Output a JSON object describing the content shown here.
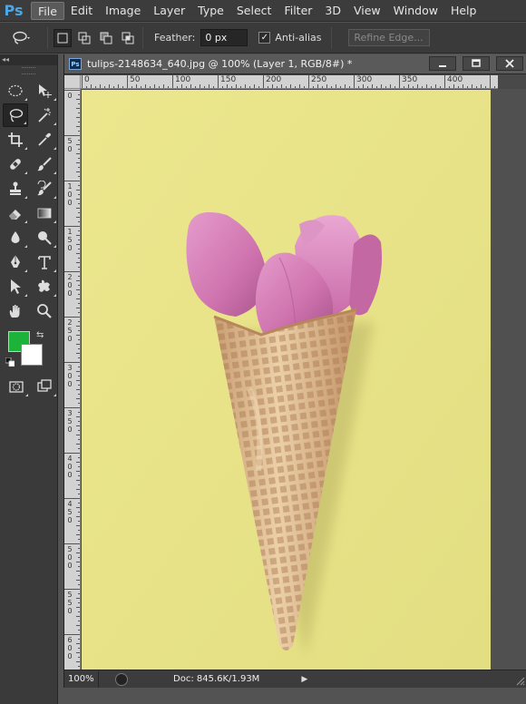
{
  "app": {
    "logo": "Ps"
  },
  "menu": [
    "File",
    "Edit",
    "Image",
    "Layer",
    "Type",
    "Select",
    "Filter",
    "3D",
    "View",
    "Window",
    "Help"
  ],
  "options": {
    "feather_label": "Feather:",
    "feather_value": "0 px",
    "antialias_label": "Anti-alias",
    "antialias_checked": true,
    "refine_edge_label": "Refine Edge..."
  },
  "toolbox": {
    "header": "◂◂",
    "tools": [
      "marquee-icon",
      "move-icon",
      "lasso-icon",
      "magic-wand-icon",
      "crop-icon",
      "eyedropper-icon",
      "healing-brush-icon",
      "brush-icon",
      "clone-stamp-icon",
      "history-brush-icon",
      "eraser-icon",
      "gradient-icon",
      "blur-icon",
      "dodge-icon",
      "pen-icon",
      "type-icon",
      "path-selection-icon",
      "custom-shape-icon",
      "hand-icon",
      "zoom-icon"
    ],
    "foreground_color": "#1db33a",
    "background_color": "#ffffff"
  },
  "document": {
    "title": "tulips-2148634_640.jpg @ 100% (Layer 1, RGB/8#) *",
    "ps_badge": "Ps",
    "ruler_h_labels": [
      "0",
      "50",
      "100",
      "150",
      "200",
      "250",
      "300",
      "350",
      "400"
    ],
    "ruler_v_labels": [
      "0",
      "5\n0",
      "1\n0\n0",
      "1\n5\n0",
      "2\n0\n0",
      "2\n5\n0",
      "3\n0\n0",
      "3\n5\n0",
      "4\n0\n0",
      "4\n5\n0",
      "5\n0\n0",
      "5\n5\n0",
      "6\n0\n0"
    ],
    "canvas_color": "#e9e48a"
  },
  "status": {
    "zoom": "100%",
    "doc_info": "Doc: 845.6K/1.93M"
  }
}
